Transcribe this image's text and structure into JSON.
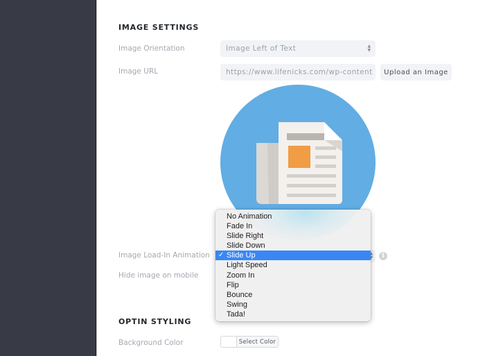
{
  "sidebar": {},
  "image_settings": {
    "section_title": "IMAGE SETTINGS",
    "orientation": {
      "label": "Image Orientation",
      "value": "Image Left of Text"
    },
    "image_url": {
      "label": "Image URL",
      "value": "https://www.lifenicks.com/wp-content",
      "upload_button": "Upload an Image"
    },
    "preview": {
      "icon": "newspaper-icon",
      "background_color": "#62ade4"
    },
    "load_in_animation": {
      "label": "Image Load-In Animation",
      "selected": "Slide Up",
      "options": [
        "No Animation",
        "Fade In",
        "Slide Right",
        "Slide Down",
        "Slide Up",
        "Light Speed",
        "Zoom In",
        "Flip",
        "Bounce",
        "Swing",
        "Tada!"
      ],
      "check_glyph": "✓",
      "info_icon": "i"
    },
    "hide_on_mobile": {
      "label": "Hide image on mobile"
    }
  },
  "optin_styling": {
    "section_title": "OPTIN STYLING",
    "background_color": {
      "label": "Background Color",
      "button": "Select Color",
      "value": "#ffffff"
    }
  },
  "colors": {
    "sidebar": "#383b45",
    "selection": "#3a87f3",
    "field_bg": "#f2f3f6"
  }
}
